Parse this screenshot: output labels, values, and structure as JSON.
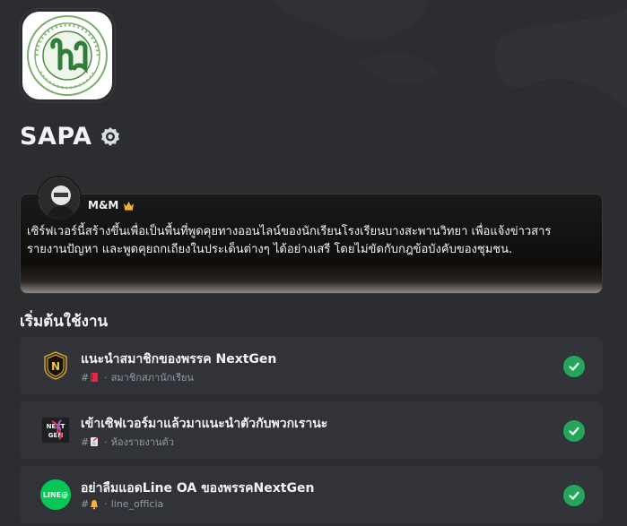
{
  "server": {
    "name": "SAPA",
    "icon": "school-emblem-icon",
    "badge_icon": "verified-icon"
  },
  "welcome": {
    "author": "M&M",
    "author_badge_icon": "crown-icon",
    "message": "เซิร์ฟเวอร์นี้สร้างขึ้นเพื่อเป็นพื้นที่พูดคุยทางออนไลน์ของนักเรียนโรงเรียนบางสะพานวิทยา เพื่อแจ้งข่าวสาร รายงานปัญหา และพูดคุยถกเถียงในประเด็นต่างๆ ได้อย่างเสรี โดยไม่ขัดกับกฎข้อบังคับของชุมชน."
  },
  "onboarding": {
    "heading": "เริ่มต้นใช้งาน",
    "tasks": [
      {
        "title": "แนะนำสมาชิกของพรรค NextGen",
        "channel": "สมาชิกสภานักเรียน",
        "channel_prefix": "#",
        "channel_emoji": "red-book-icon",
        "icon": "nextgen-badge-icon",
        "completed": true
      },
      {
        "title": "เข้าเซิฟเวอร์มาแล้วมาแนะนำตัวกับพวกเรานะ",
        "channel": "ห้องรายงานตัว",
        "channel_prefix": "#",
        "channel_emoji": "memo-icon",
        "icon": "nextgen-logo-icon",
        "completed": true
      },
      {
        "title": "อย่าลืมแอดLine OA ของพรรคNextGen",
        "channel": "line_officia",
        "channel_prefix": "#",
        "channel_emoji": "bell-icon",
        "icon": "line-icon",
        "icon_text": "LINE@",
        "completed": true
      }
    ]
  },
  "colors": {
    "background": "#2b2d31",
    "card": "#313338",
    "success": "#23a55a",
    "line_green": "#06c755"
  }
}
